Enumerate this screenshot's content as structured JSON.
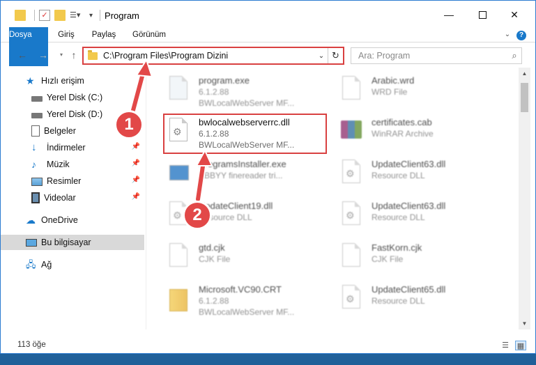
{
  "window": {
    "title": "Program"
  },
  "ribbon": {
    "tabs": [
      "Dosya",
      "Giriş",
      "Paylaş",
      "Görünüm"
    ]
  },
  "address": {
    "path": "C:\\Program Files\\Program Dizini"
  },
  "search": {
    "placeholder": "Ara: Program"
  },
  "sidebar": {
    "items": [
      {
        "label": "Hızlı erişim",
        "icon": "star-icon"
      },
      {
        "label": "Yerel Disk (C:)",
        "icon": "drive-icon"
      },
      {
        "label": "Yerel Disk (D:)",
        "icon": "drive-icon"
      },
      {
        "label": "Belgeler",
        "icon": "documents-icon"
      },
      {
        "label": "İndirmeler",
        "icon": "download-icon"
      },
      {
        "label": "Müzik",
        "icon": "music-icon"
      },
      {
        "label": "Resimler",
        "icon": "pictures-icon"
      },
      {
        "label": "Videolar",
        "icon": "videos-icon"
      },
      {
        "label": "OneDrive",
        "icon": "cloud-icon"
      },
      {
        "label": "Bu bilgisayar",
        "icon": "computer-icon"
      },
      {
        "label": "Ağ",
        "icon": "network-icon"
      }
    ]
  },
  "files": [
    {
      "name": "program.exe",
      "line2": "6.1.2.88",
      "line3": "BWLocalWebServer MF...",
      "icon": "exe-icon"
    },
    {
      "name": "Arabic.wrd",
      "line2": "WRD File",
      "line3": "",
      "icon": "file-icon"
    },
    {
      "name": "bwlocalwebserverrc.dll",
      "line2": "6.1.2.88",
      "line3": "BWLocalWebServer MF...",
      "icon": "dll-icon"
    },
    {
      "name": "certificates.cab",
      "line2": "WinRAR Archive",
      "line3": "",
      "icon": "archive-icon"
    },
    {
      "name": "ProgramsInstaller.exe",
      "line2": "ABBYY finereader tri...",
      "line3": "",
      "icon": "installer-icon"
    },
    {
      "name": "UpdateClient63.dll",
      "line2": "Resource DLL",
      "line3": "",
      "icon": "dll-icon"
    },
    {
      "name": "UpdateClient19.dll",
      "line2": "Resource DLL",
      "line3": "",
      "icon": "dll-icon"
    },
    {
      "name": "UpdateClient63.dll",
      "line2": "Resource DLL",
      "line3": "",
      "icon": "dll-icon"
    },
    {
      "name": "gtd.cjk",
      "line2": "CJK File",
      "line3": "",
      "icon": "file-icon"
    },
    {
      "name": "FastKorn.cjk",
      "line2": "CJK File",
      "line3": "",
      "icon": "file-icon"
    },
    {
      "name": "Microsoft.VC90.CRT",
      "line2": "6.1.2.88",
      "line3": "BWLocalWebServer MF...",
      "icon": "folder-icon"
    },
    {
      "name": "UpdateClient65.dll",
      "line2": "Resource DLL",
      "line3": "",
      "icon": "dll-icon"
    }
  ],
  "status": {
    "count": "113 öğe"
  },
  "callouts": [
    "1",
    "2"
  ],
  "colors": {
    "accent": "#1979ca",
    "highlight": "#d94040",
    "callout": "#e24848"
  }
}
